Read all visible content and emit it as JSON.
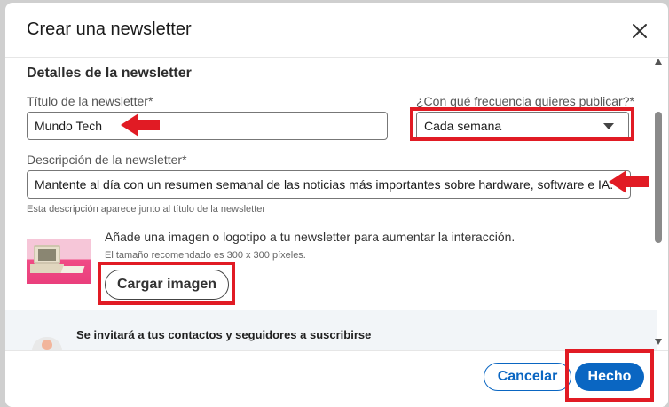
{
  "dialog": {
    "title": "Crear una newsletter",
    "close_icon": "close-icon"
  },
  "details": {
    "section_title": "Detalles de la newsletter",
    "title_label": "Título de la newsletter*",
    "title_value": "Mundo Tech",
    "frequency_label": "¿Con qué frecuencia quieres publicar?*",
    "frequency_value": "Cada semana",
    "description_label": "Descripción de la newsletter*",
    "description_value": "Mantente al día con un resumen semanal de las noticias más importantes sobre hardware, software e IA.",
    "description_hint": "Esta descripción aparece junto al título de la newsletter"
  },
  "image": {
    "description": "Añade una imagen o logotipo a tu newsletter para aumentar la interacción.",
    "size_hint": "El tamaño recomendado es 300 x 300 píxeles.",
    "upload_label": "Cargar imagen"
  },
  "invite": {
    "text": "Se invitará a tus contactos y seguidores a suscribirse"
  },
  "footer": {
    "cancel_label": "Cancelar",
    "done_label": "Hecho"
  },
  "colors": {
    "primary": "#0a66c2",
    "highlight": "#e11b24"
  }
}
